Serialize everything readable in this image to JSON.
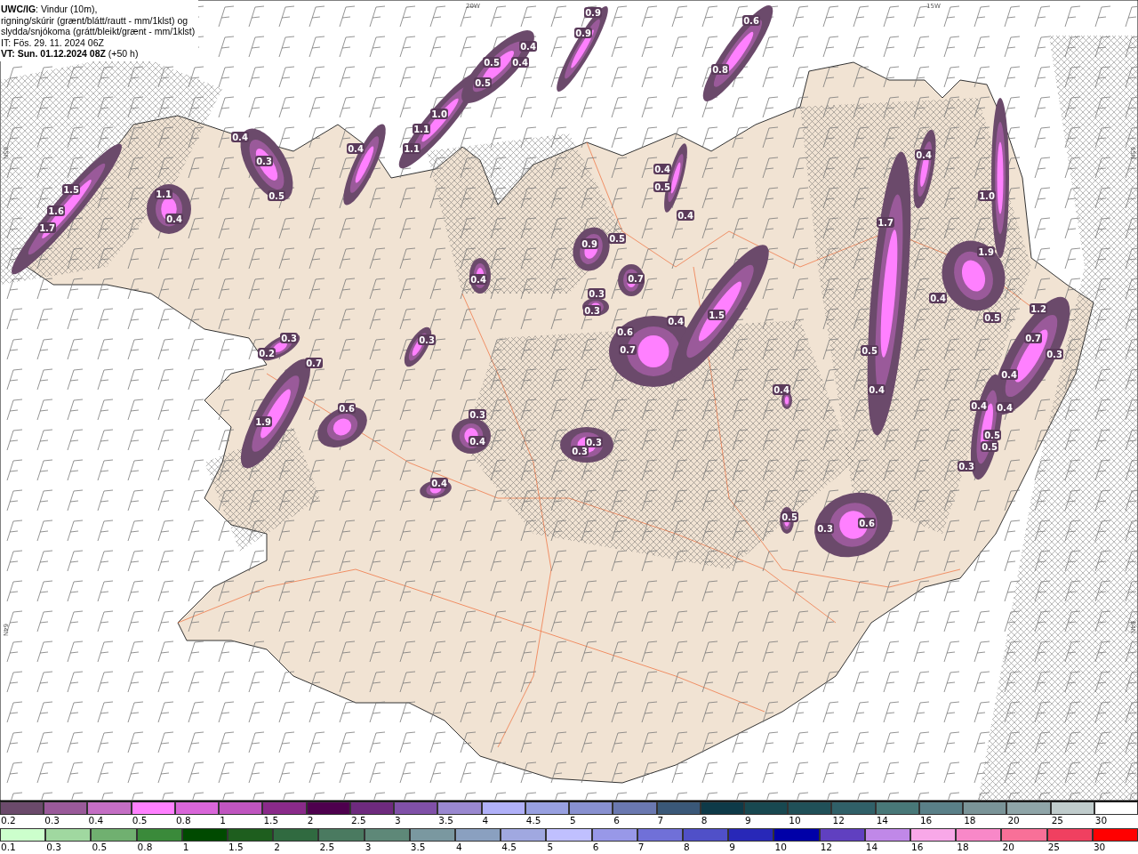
{
  "header": {
    "lines": [
      "**UWC/IG**: Vindur (10m),",
      "rigning/skúrir (grænt/blátt/rautt - mm/1klst) og",
      "slydda/snjókoma (grátt/bleikt/grænt - mm/1klst)",
      "IT: Fös. 29. 11. 2024 06Z",
      "**VT: Sun. 01.12.2024 08Z** (+50 h)"
    ]
  },
  "map": {
    "axis_labels": [
      "20W",
      "15W",
      "65N",
      "65N",
      "64N",
      "64N"
    ],
    "precip_labels": [
      "0.9",
      "0.9",
      "0.6",
      "0.8",
      "0.4",
      "0.5",
      "0.4",
      "0.5",
      "1.0",
      "1.1",
      "1.1",
      "0.4",
      "0.3",
      "0.5",
      "1.5",
      "1.6",
      "1.7",
      "1.1",
      "0.4",
      "0.4",
      "0.4",
      "0.3",
      "0.3",
      "0.2",
      "0.7",
      "1.9",
      "0.6",
      "0.3",
      "0.4",
      "0.4",
      "0.4",
      "0.5",
      "0.4",
      "0.9",
      "0.5",
      "0.7",
      "0.3",
      "0.3",
      "0.6",
      "0.7",
      "0.4",
      "1.5",
      "0.4",
      "1.7",
      "0.4",
      "0.5",
      "0.4",
      "1.0",
      "1.9",
      "0.4",
      "0.5",
      "1.2",
      "0.7",
      "0.3",
      "0.4",
      "0.4",
      "0.4",
      "0.5",
      "0.5",
      "0.3",
      "0.3",
      "0.3",
      "0.5",
      "0.3",
      "0.6"
    ]
  },
  "legend": {
    "snow_scale": [
      {
        "label": "0.2",
        "color": "#6b4a6b"
      },
      {
        "label": "0.3",
        "color": "#9a5a9a"
      },
      {
        "label": "0.4",
        "color": "#c46ec4"
      },
      {
        "label": "0.5",
        "color": "#ff80ff"
      },
      {
        "label": "0.8",
        "color": "#d966d9"
      },
      {
        "label": "1",
        "color": "#c055c0"
      },
      {
        "label": "1.5",
        "color": "#8a2a8a"
      },
      {
        "label": "2",
        "color": "#4e004e"
      },
      {
        "label": "2.5",
        "color": "#6e2a7e"
      },
      {
        "label": "3",
        "color": "#8050a8"
      },
      {
        "label": "3.5",
        "color": "#9a88d0"
      },
      {
        "label": "4",
        "color": "#b0b0f8"
      },
      {
        "label": "4.5",
        "color": "#98a0e0"
      },
      {
        "label": "5",
        "color": "#8890d0"
      },
      {
        "label": "6",
        "color": "#6a78b0"
      },
      {
        "label": "7",
        "color": "#3a5878"
      },
      {
        "label": "8",
        "color": "#0e3a48"
      },
      {
        "label": "9",
        "color": "#184850"
      },
      {
        "label": "10",
        "color": "#205058"
      },
      {
        "label": "12",
        "color": "#306068"
      },
      {
        "label": "14",
        "color": "#487878"
      },
      {
        "label": "16",
        "color": "#5a8088"
      },
      {
        "label": "18",
        "color": "#7a9498"
      },
      {
        "label": "20",
        "color": "#8fa5a8"
      },
      {
        "label": "25",
        "color": "#c0cccc"
      },
      {
        "label": "30",
        "color": "#ffffff"
      }
    ],
    "rain_scale": [
      {
        "label": "0.1",
        "color": "#ccffcc"
      },
      {
        "label": "0.3",
        "color": "#a0d8a0"
      },
      {
        "label": "0.5",
        "color": "#70b070"
      },
      {
        "label": "0.8",
        "color": "#3a8a3a"
      },
      {
        "label": "1",
        "color": "#004a00"
      },
      {
        "label": "1.5",
        "color": "#1e5e1e"
      },
      {
        "label": "2",
        "color": "#306a40"
      },
      {
        "label": "2.5",
        "color": "#4a7a60"
      },
      {
        "label": "3",
        "color": "#5e8878"
      },
      {
        "label": "3.5",
        "color": "#7a98a0"
      },
      {
        "label": "4",
        "color": "#8aa0c0"
      },
      {
        "label": "4.5",
        "color": "#a0a8e0"
      },
      {
        "label": "5",
        "color": "#c0c0ff"
      },
      {
        "label": "6",
        "color": "#9898e8"
      },
      {
        "label": "7",
        "color": "#7070d8"
      },
      {
        "label": "8",
        "color": "#5050c8"
      },
      {
        "label": "9",
        "color": "#2828b8"
      },
      {
        "label": "10",
        "color": "#0000a8"
      },
      {
        "label": "12",
        "color": "#6040c0"
      },
      {
        "label": "14",
        "color": "#c088e8"
      },
      {
        "label": "16",
        "color": "#f8a8e8"
      },
      {
        "label": "18",
        "color": "#f888c8"
      },
      {
        "label": "20",
        "color": "#f87098"
      },
      {
        "label": "25",
        "color": "#f04060"
      },
      {
        "label": "30",
        "color": "#ff0000"
      }
    ]
  }
}
